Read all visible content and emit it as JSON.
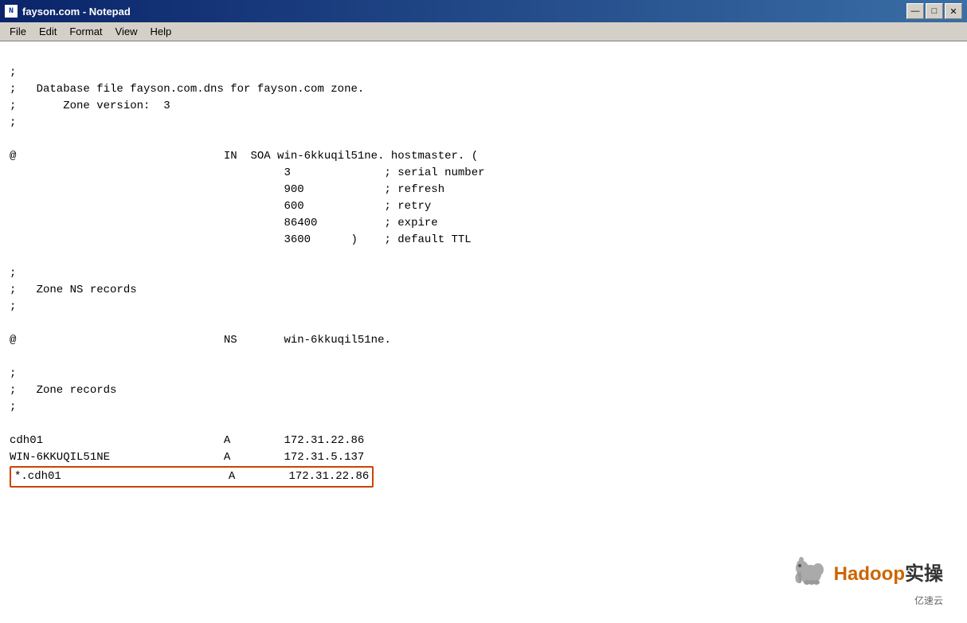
{
  "window": {
    "title": "fayson.com - Notepad",
    "icon": "📄"
  },
  "title_controls": {
    "minimize": "—",
    "maximize": "□",
    "close": "✕"
  },
  "menu": {
    "items": [
      "File",
      "Edit",
      "Format",
      "View",
      "Help"
    ]
  },
  "editor": {
    "lines": [
      ";",
      ";   Database file fayson.com.dns for fayson.com zone.",
      ";       Zone version:  3",
      ";",
      "",
      "@                               IN  SOA win-6kkuqil51ne. hostmaster. (",
      "                                         3              ; serial number",
      "                                         900            ; refresh",
      "                                         600            ; retry",
      "                                         86400          ; expire",
      "                                         3600      )    ; default TTL",
      "",
      ";",
      ";   Zone NS records",
      ";",
      "",
      "@                               NS       win-6kkuqil51ne.",
      "",
      ";",
      ";   Zone records",
      ";",
      "",
      "cdh01                           A        172.31.22.86",
      "WIN-6KKUQIL51NE                 A        172.31.5.137"
    ],
    "highlighted_line": "*.cdh01                         A        172.31.22.86"
  },
  "branding": {
    "main": "Hadoop实操",
    "sub": "亿速云"
  }
}
